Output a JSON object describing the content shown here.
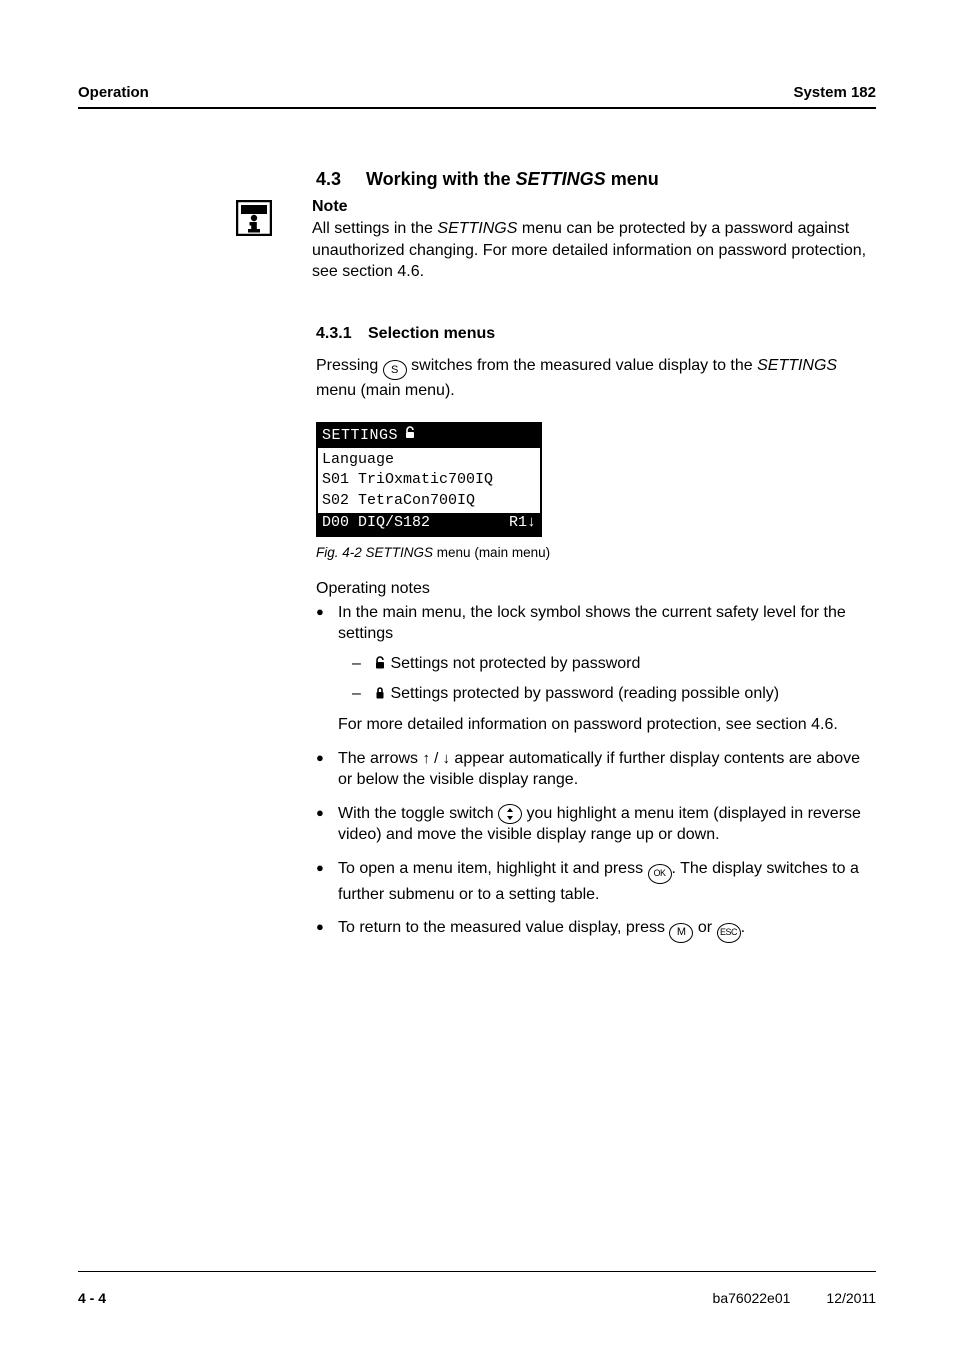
{
  "header": {
    "left": "Operation",
    "right": "System 182"
  },
  "section": {
    "num": "4.3",
    "title_pre": "Working with the ",
    "title_ital": "SETTINGS",
    "title_post": " menu"
  },
  "note": {
    "label": "Note",
    "line_pre": "All settings in the ",
    "line_ital": "SETTINGS",
    "line_post": " menu can be protected by a password against unauthorized changing. For more detailed information on password protection, see section 4.6."
  },
  "sub": {
    "num": "4.3.1",
    "title": "Selection menus"
  },
  "press": {
    "pre": "Pressing ",
    "key": "S",
    "mid": " switches from the measured value display to the ",
    "ital": "SETTINGS",
    "post": " menu (main menu)."
  },
  "lcd": {
    "title": "SETTINGS",
    "row1": "Language",
    "row2": "S01 TriOxmatic700IQ",
    "row3": "S02 TetraCon700IQ",
    "sel_left": "D00 DIQ/S182",
    "sel_right": "R1↓"
  },
  "figcap": {
    "pre": "Fig. 4-2    ",
    "ital": "SETTINGS",
    "post": " menu (main menu)"
  },
  "opnotes": "Operating notes",
  "b1": "In the main menu, the lock symbol shows the current safety level for the settings",
  "b1a": "Settings not protected by password",
  "b1b": "Settings protected by password (reading possible only)",
  "b1_tail": "For more detailed information on password protection, see section 4.6.",
  "b2_pre": "The arrows  ",
  "b2_post": " appear automatically if further display contents are above or below the visible display range.",
  "b3_pre": "With the toggle switch ",
  "b3_post": " you highlight a menu item (displayed in reverse video) and  move the visible display range up or down.",
  "b4_pre": "To open a menu item, highlight it and press ",
  "b4_key": "OK",
  "b4_post": ". The display switches to a further submenu or to a setting table.",
  "b5_pre": "To return to the measured value display, press ",
  "b5_key1": "M",
  "b5_mid": " or ",
  "b5_key2": "ESC",
  "b5_post": ".",
  "footer": {
    "page": "4 - 4",
    "doc": "ba76022e01",
    "date": "12/2011"
  }
}
